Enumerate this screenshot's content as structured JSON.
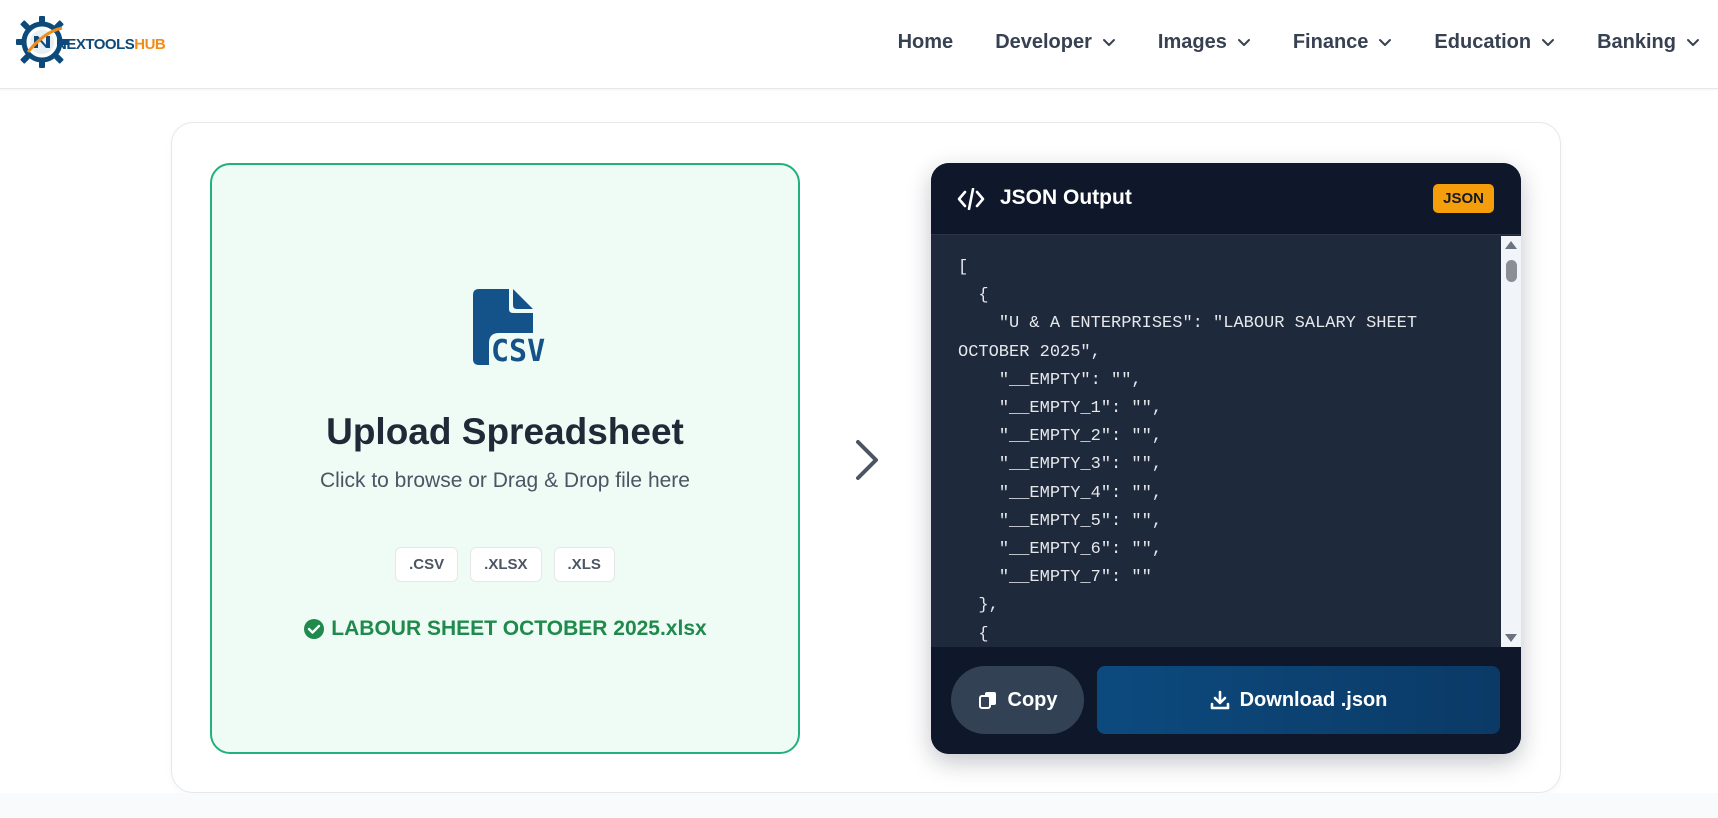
{
  "header": {
    "logo": {
      "text_prefix": "NEXTOO",
      "text_middle": "LS",
      "text_suffix": "HUB",
      "icon": "gear-logo-icon"
    },
    "nav": [
      {
        "label": "Home",
        "has_dropdown": false
      },
      {
        "label": "Developer",
        "has_dropdown": true
      },
      {
        "label": "Images",
        "has_dropdown": true
      },
      {
        "label": "Finance",
        "has_dropdown": true
      },
      {
        "label": "Education",
        "has_dropdown": true
      },
      {
        "label": "Banking",
        "has_dropdown": true
      }
    ]
  },
  "upload": {
    "icon": "csv-file-icon",
    "title": "Upload Spreadsheet",
    "subtitle": "Click to browse or Drag & Drop file here",
    "formats": [
      ".CSV",
      ".XLSX",
      ".XLS"
    ],
    "selected_file": "LABOUR SHEET OCTOBER 2025.xlsx"
  },
  "output": {
    "title": "JSON Output",
    "badge": "JSON",
    "code": "[\n  {\n    \"U & A ENTERPRISES\": \"LABOUR SALARY SHEET OCTOBER 2025\",\n    \"__EMPTY\": \"\",\n    \"__EMPTY_1\": \"\",\n    \"__EMPTY_2\": \"\",\n    \"__EMPTY_3\": \"\",\n    \"__EMPTY_4\": \"\",\n    \"__EMPTY_5\": \"\",\n    \"__EMPTY_6\": \"\",\n    \"__EMPTY_7\": \"\"\n  },\n  {",
    "copy_label": "Copy",
    "download_label": "Download .json"
  },
  "colors": {
    "accent_green": "#22b07d",
    "panel_dark": "#0f172a",
    "badge": "#f59e0b",
    "download_blue": "#0c4a7e"
  }
}
